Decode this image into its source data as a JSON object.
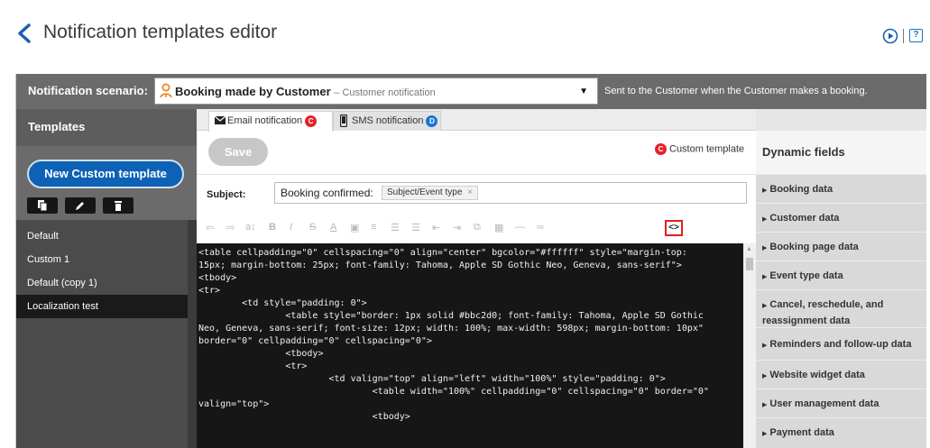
{
  "header": {
    "title": "Notification templates editor",
    "help_label": "?"
  },
  "scenario": {
    "label": "Notification scenario:",
    "selected": "Booking made by Customer",
    "selected_sub": "– Customer notification",
    "description": "Sent to the Customer when the Customer makes a booking."
  },
  "sidebar": {
    "title": "Templates",
    "new_button": "New Custom template",
    "items": [
      {
        "label": "Default"
      },
      {
        "label": "Custom 1"
      },
      {
        "label": "Default (copy 1)"
      },
      {
        "label": "Localization test"
      }
    ],
    "active_index": 3
  },
  "tabs": [
    {
      "label": "Email notification",
      "badge": "C",
      "badge_color": "#e8202a"
    },
    {
      "label": "SMS notification",
      "badge": "D",
      "badge_color": "#1976d2"
    }
  ],
  "editor": {
    "save_label": "Save",
    "custom_badge": "C",
    "custom_label": "Custom template",
    "subject_label": "Subject:",
    "subject_text": "Booking confirmed:",
    "subject_token": "Subject/Event type",
    "subject_token_remove": "×",
    "source_button": "<>",
    "code_lines": [
      "<table cellpadding=\"0\" cellspacing=\"0\" align=\"center\" bgcolor=\"#ffffff\" style=\"margin-top:",
      "15px; margin-bottom: 25px; font-family: Tahoma, Apple SD Gothic Neo, Geneva, sans-serif\">",
      "<tbody>",
      "<tr>",
      "        <td style=\"padding: 0\">",
      "                <table style=\"border: 1px solid #bbc2d0; font-family: Tahoma, Apple SD Gothic",
      "Neo, Geneva, sans-serif; font-size: 12px; width: 100%; max-width: 598px; margin-bottom: 10px\"",
      "border=\"0\" cellpadding=\"0\" cellspacing=\"0\">",
      "                <tbody>",
      "                <tr>",
      "                        <td valign=\"top\" align=\"left\" width=\"100%\" style=\"padding: 0\">",
      "                                <table width=\"100%\" cellpadding=\"0\" cellspacing=\"0\" border=\"0\"",
      "valign=\"top\">",
      "                                <tbody>"
    ]
  },
  "dynamic_fields": {
    "title": "Dynamic fields",
    "items": [
      {
        "label": "Booking data"
      },
      {
        "label": "Customer data"
      },
      {
        "label": "Booking page data"
      },
      {
        "label": "Event type data"
      },
      {
        "label": "Cancel, reschedule, and reassignment data"
      },
      {
        "label": "Reminders and follow-up data"
      },
      {
        "label": "Website widget data"
      },
      {
        "label": "User management data"
      },
      {
        "label": "Payment data"
      }
    ]
  },
  "colors": {
    "accent_blue": "#0d62b5",
    "badge_red": "#e8202a",
    "badge_blue": "#1976d2",
    "scenario_icon": "#f07a18",
    "highlight_red": "#e0201c"
  }
}
